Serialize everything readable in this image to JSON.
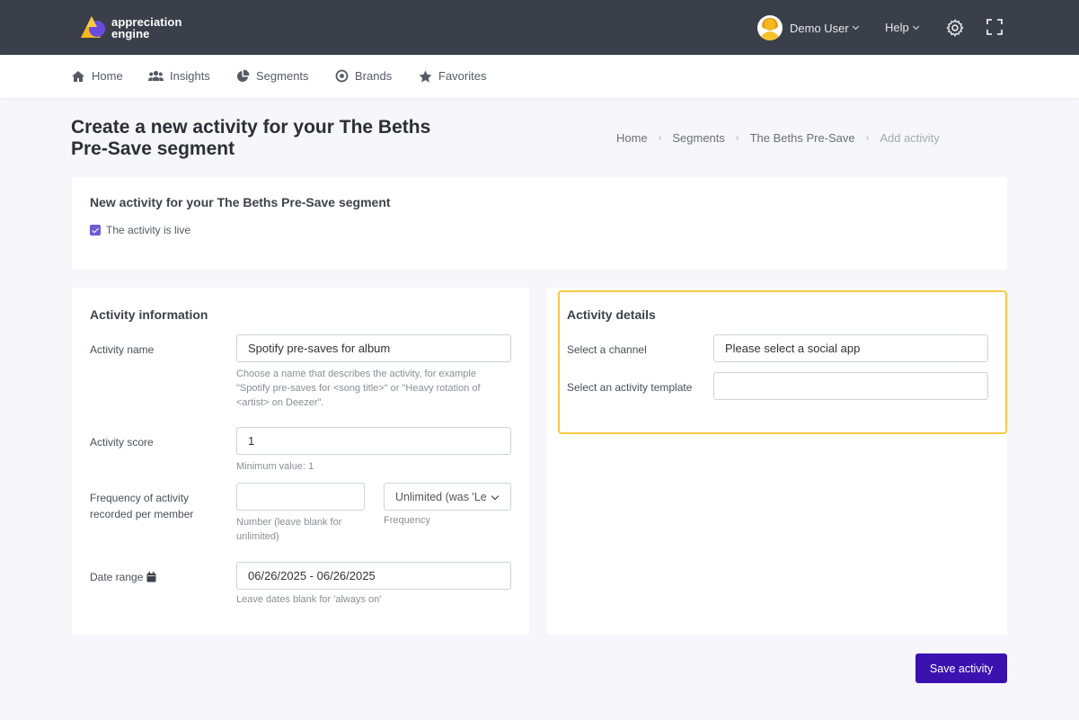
{
  "brand": {
    "logo_line1": "appreciation",
    "logo_line2": "engine"
  },
  "header": {
    "user_name": "Demo User",
    "help_label": "Help"
  },
  "nav": {
    "items": [
      {
        "label": "Home",
        "icon": "home-icon"
      },
      {
        "label": "Insights",
        "icon": "users-icon"
      },
      {
        "label": "Segments",
        "icon": "pie-chart-icon"
      },
      {
        "label": "Brands",
        "icon": "target-icon"
      },
      {
        "label": "Favorites",
        "icon": "star-icon"
      }
    ]
  },
  "page": {
    "title": "Create a new activity for your The Beths Pre-Save segment",
    "breadcrumb": [
      "Home",
      "Segments",
      "The Beths Pre-Save",
      "Add activity"
    ]
  },
  "status_card": {
    "title": "New activity for your The Beths Pre-Save segment",
    "live_checkbox_label": "The activity is live",
    "live_checked": true
  },
  "activity_info": {
    "title": "Activity information",
    "name_label": "Activity name",
    "name_value": "Spotify pre-saves for album",
    "name_help": "Choose a name that describes the activity, for example \"Spotify pre-saves for <song title>\" or \"Heavy rotation of <artist> on Deezer\".",
    "score_label": "Activity score",
    "score_value": "1",
    "score_help": "Minimum value: 1",
    "frequency_label": "Frequency of activity recorded per member",
    "frequency_number_value": "",
    "frequency_number_help": "Number (leave blank for unlimited)",
    "frequency_select_value": "Unlimited (was 'Le",
    "frequency_select_help": "Frequency",
    "date_label": "Date range",
    "date_value": "06/26/2025 - 06/26/2025",
    "date_help": "Leave dates blank for 'always on'"
  },
  "activity_details": {
    "title": "Activity details",
    "channel_label": "Select a channel",
    "channel_value": "Please select a social app",
    "template_label": "Select an activity template",
    "template_value": ""
  },
  "actions": {
    "save_label": "Save activity"
  },
  "colors": {
    "topbar": "#3a3f49",
    "accent": "#3b12b0",
    "checkbox": "#6f5bd6",
    "highlight": "#f7c948"
  }
}
